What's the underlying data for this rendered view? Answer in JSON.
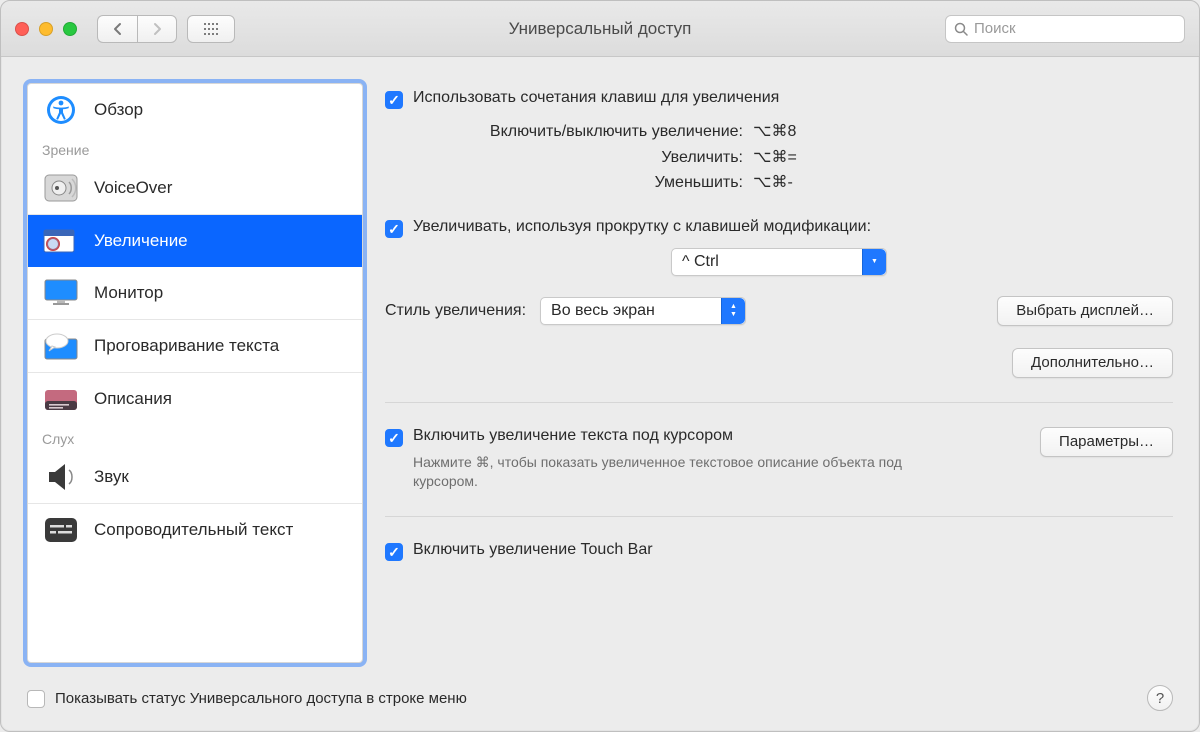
{
  "window": {
    "title": "Универсальный доступ",
    "search_placeholder": "Поиск"
  },
  "sidebar": {
    "cat_vision": "Зрение",
    "cat_hearing": "Слух",
    "items": {
      "overview": "Обзор",
      "voiceover": "VoiceOver",
      "zoom": "Увеличение",
      "display": "Монитор",
      "speech": "Проговаривание текста",
      "descriptions": "Описания",
      "audio": "Звук",
      "captions": "Сопроводительный текст"
    }
  },
  "panel": {
    "use_shortcuts": "Использовать сочетания клавиш для увеличения",
    "kv": {
      "toggle": {
        "k": "Включить/выключить увеличение:",
        "v": "⌥⌘8"
      },
      "zoom_in": {
        "k": "Увеличить:",
        "v": "⌥⌘="
      },
      "zoom_out": {
        "k": "Уменьшить:",
        "v": "⌥⌘-"
      }
    },
    "scroll_mod": "Увеличивать, используя прокрутку с клавишей модификации:",
    "modifier_value": "^ Ctrl",
    "zoom_style_label": "Стиль увеличения:",
    "zoom_style_value": "Во весь экран",
    "choose_display": "Выбрать дисплей…",
    "advanced": "Дополнительно…",
    "hover_text": "Включить увеличение текста под курсором",
    "hover_hint": "Нажмите ⌘, чтобы показать увеличенное текстовое описание объекта под курсором.",
    "options": "Параметры…",
    "touchbar": "Включить увеличение Touch Bar"
  },
  "footer": {
    "show_in_menubar": "Показывать статус Универсального доступа в строке меню"
  }
}
